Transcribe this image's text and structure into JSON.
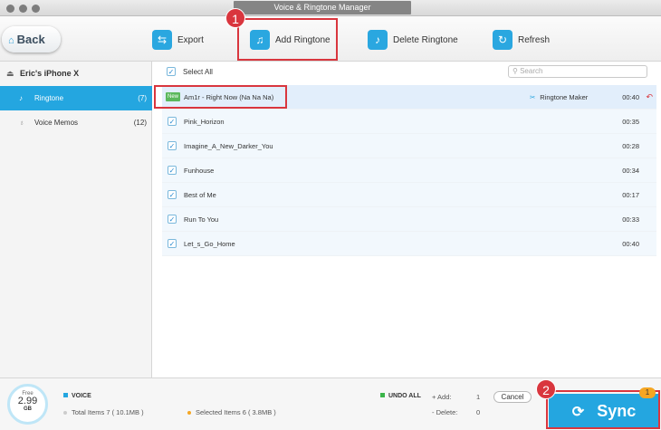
{
  "window": {
    "title": "Voice & Ringtone Manager"
  },
  "toolbar": {
    "back_label": "Back",
    "export_label": "Export",
    "add_label": "Add Ringtone",
    "delete_label": "Delete Ringtone",
    "refresh_label": "Refresh"
  },
  "markers": {
    "one": "1",
    "two": "2"
  },
  "sidebar": {
    "device": "Eric's iPhone X",
    "items": [
      {
        "label": "Ringtone",
        "count": "(7)"
      },
      {
        "label": "Voice Memos",
        "count": "(12)"
      }
    ]
  },
  "list": {
    "select_all": "Select All",
    "search_placeholder": "Search",
    "new_tag": "New",
    "ringtone_maker": "Ringtone Maker",
    "rows": [
      {
        "name": "Am1r - Right Now (Na Na Na)",
        "duration": "00:40"
      },
      {
        "name": "Pink_Horizon",
        "duration": "00:35"
      },
      {
        "name": "Imagine_A_New_Darker_You",
        "duration": "00:28"
      },
      {
        "name": "Funhouse",
        "duration": "00:34"
      },
      {
        "name": "Best of Me",
        "duration": "00:17"
      },
      {
        "name": "Run To You",
        "duration": "00:33"
      },
      {
        "name": "Let_s_Go_Home",
        "duration": "00:40"
      }
    ]
  },
  "footer": {
    "free_label": "Free",
    "free_value": "2.99",
    "free_unit": "GB",
    "voice_label": "VOICE",
    "total_items": "Total Items 7 ( 10.1MB )",
    "selected_items": "Selected Items 6 ( 3.8MB )",
    "undo_all": "UNDO ALL",
    "add_label": "+ Add:",
    "add_value": "1",
    "delete_label": "- Delete:",
    "delete_value": "0",
    "cancel_label": "Cancel",
    "sync_label": "Sync",
    "sync_badge": "1"
  },
  "colors": {
    "accent": "#24a6e0",
    "highlight": "#d9363e",
    "new_tag": "#5bb85c",
    "badge": "#f5a623"
  }
}
